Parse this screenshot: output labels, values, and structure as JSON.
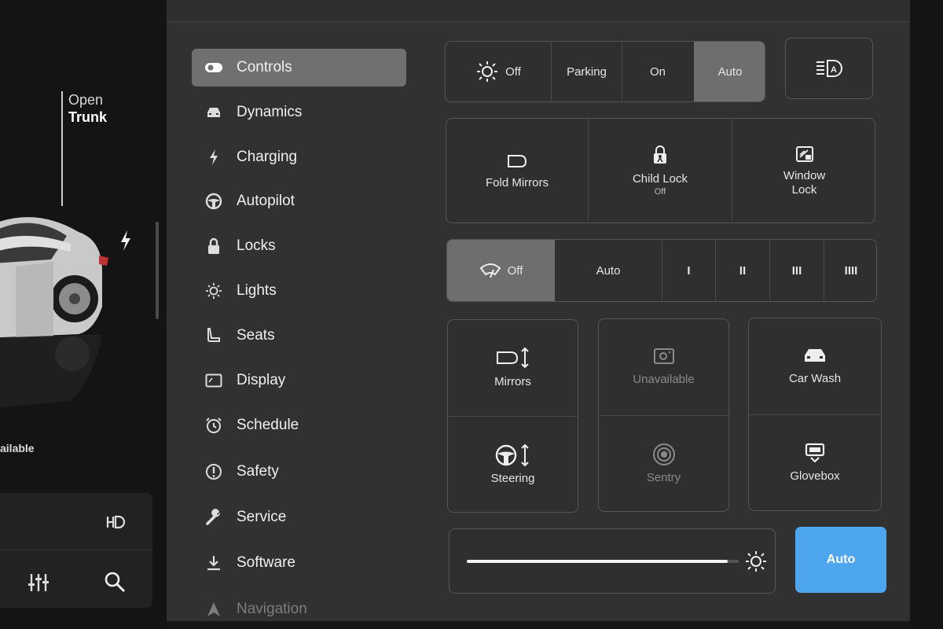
{
  "car_panel": {
    "trunk_line1": "Open",
    "trunk_line2": "Trunk",
    "unavailable_fragment": "ailable"
  },
  "nav": {
    "items": [
      {
        "label": "Controls",
        "icon": "toggle-icon"
      },
      {
        "label": "Dynamics",
        "icon": "car-icon"
      },
      {
        "label": "Charging",
        "icon": "lightning-icon"
      },
      {
        "label": "Autopilot",
        "icon": "steering-wheel-icon"
      },
      {
        "label": "Locks",
        "icon": "lock-icon"
      },
      {
        "label": "Lights",
        "icon": "sun-icon"
      },
      {
        "label": "Seats",
        "icon": "seat-icon"
      },
      {
        "label": "Display",
        "icon": "display-icon"
      },
      {
        "label": "Schedule",
        "icon": "alarm-clock-icon"
      },
      {
        "label": "Safety",
        "icon": "alert-circle-icon"
      },
      {
        "label": "Service",
        "icon": "wrench-icon"
      },
      {
        "label": "Software",
        "icon": "download-icon"
      },
      {
        "label": "Navigation",
        "icon": "navigation-arrow-icon"
      }
    ]
  },
  "headlights": {
    "options": [
      "Off",
      "Parking",
      "On",
      "Auto"
    ],
    "selected": "Auto"
  },
  "quick_buttons": {
    "fold_mirrors": "Fold Mirrors",
    "child_lock": "Child Lock",
    "child_lock_state": "Off",
    "window_lock_1": "Window",
    "window_lock_2": "Lock"
  },
  "wipers": {
    "options": [
      "Off",
      "Auto",
      "I",
      "II",
      "III",
      "IIII"
    ],
    "selected": "Off"
  },
  "grid": {
    "mirrors": "Mirrors",
    "unavailable": "Unavailable",
    "car_wash": "Car Wash",
    "steering": "Steering",
    "sentry": "Sentry",
    "glovebox": "Glovebox"
  },
  "brightness": {
    "level": 0.96,
    "auto_label": "Auto",
    "accent": "#4ea6ee"
  }
}
